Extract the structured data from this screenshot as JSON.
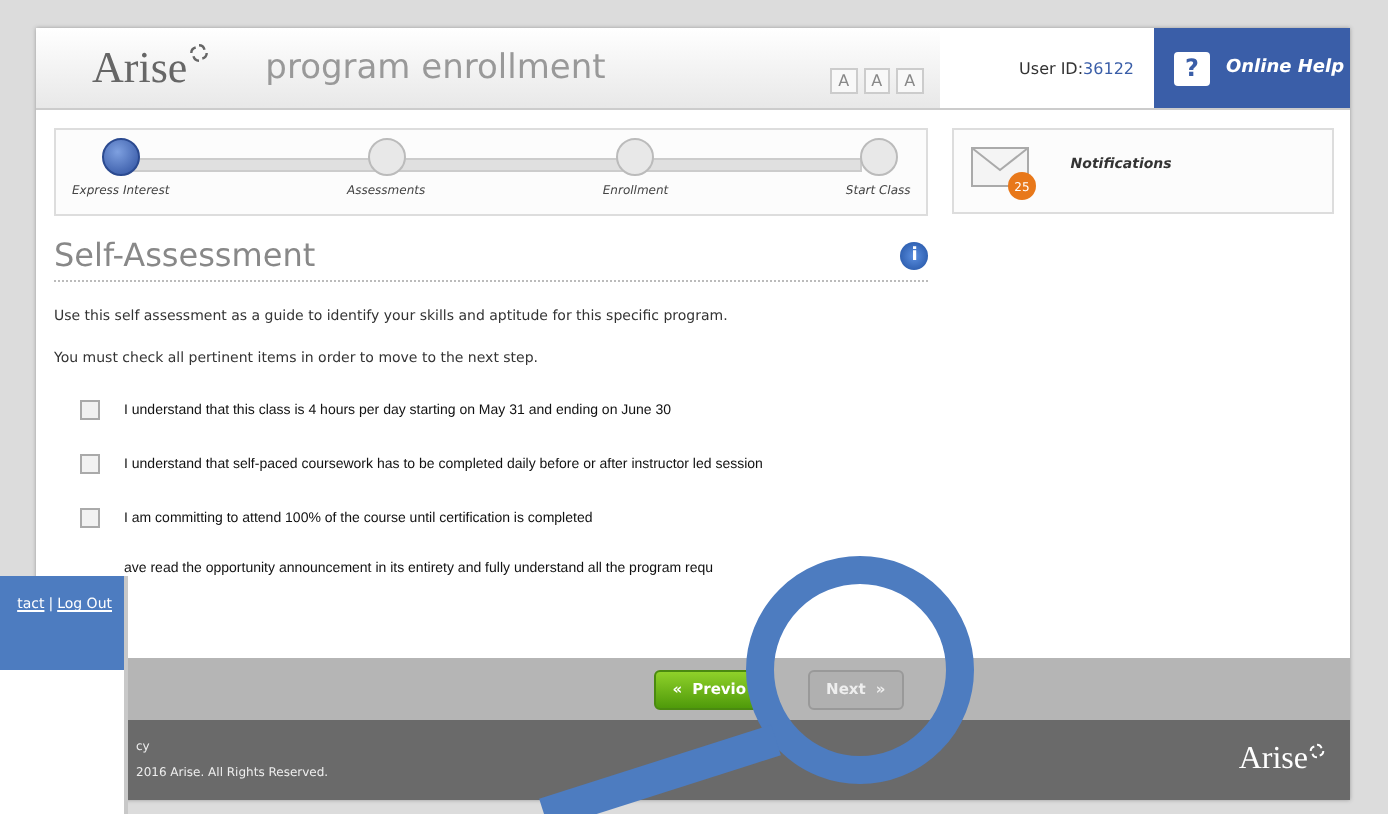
{
  "header": {
    "logo": "Arise",
    "title": "program enrollment",
    "font_sizes": [
      "A",
      "A",
      "A"
    ],
    "user_id_label": "User ID:",
    "user_id": "36122",
    "help_icon": "?",
    "help": "Online Help"
  },
  "steps": [
    {
      "label": "Express Interest",
      "selected": true
    },
    {
      "label": "Assessments",
      "selected": false
    },
    {
      "label": "Enrollment",
      "selected": false
    },
    {
      "label": "Start Class",
      "selected": false
    }
  ],
  "notifications": {
    "label": "Notifications",
    "badge": "25"
  },
  "section": {
    "title": "Self-Assessment",
    "info_icon": "i",
    "paragraphs": [
      "Use this self assessment as a guide to identify your skills and aptitude for this specific program.",
      "You must check all pertinent items in order to move to the next step."
    ]
  },
  "items": [
    {
      "text": "I understand that this class is 4 hours per day starting on May 31 and ending on June 30",
      "checked": false
    },
    {
      "text": "I understand that self-paced coursework has to be completed daily before or after instructor led session",
      "checked": false
    },
    {
      "text": "I am committing to attend 100% of the course until certification is completed",
      "checked": false
    },
    {
      "text": "ave read the opportunity announcement in its entirety and fully understand all the program requ"
    }
  ],
  "buttons": [
    {
      "label": "Previo",
      "icon": "«",
      "kind": "primary"
    },
    {
      "label": "Next",
      "icon": "»",
      "kind": "disabled"
    }
  ],
  "footer": {
    "links": [
      "cy"
    ],
    "copyright": "2016 Arise. All Rights Reserved.",
    "logo": "Arise"
  },
  "overlay": {
    "links": [
      "tact",
      "Log Out"
    ],
    "separator": "|"
  }
}
